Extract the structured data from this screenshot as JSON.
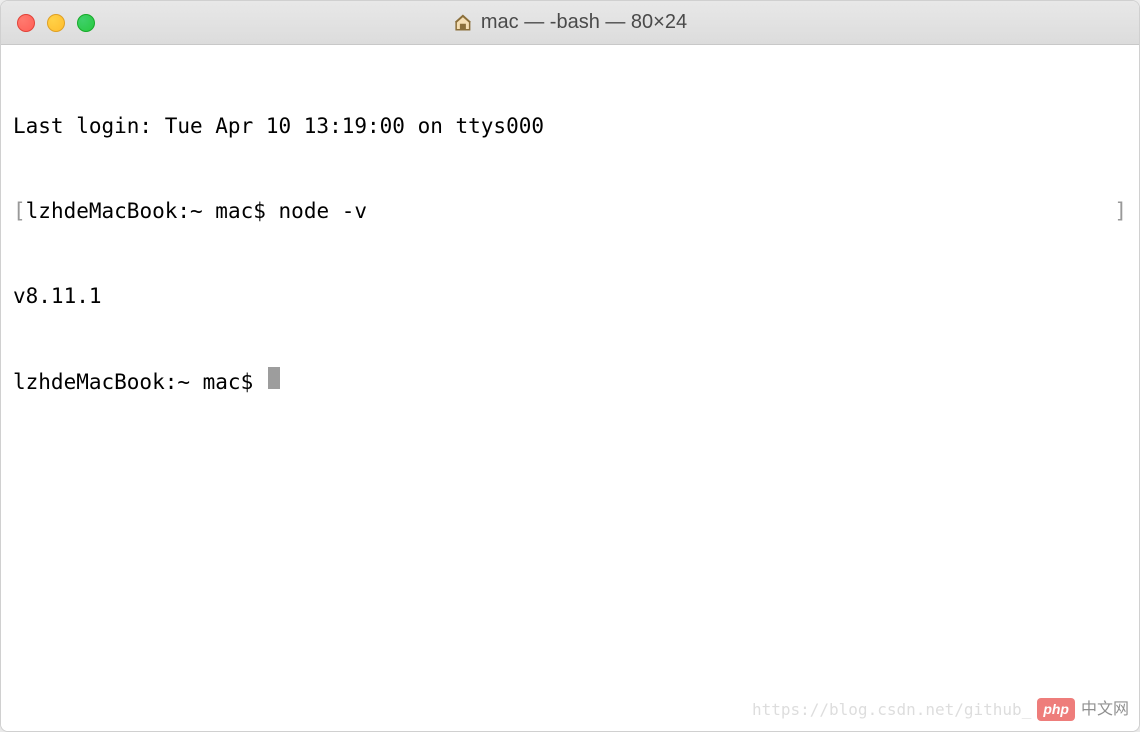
{
  "window": {
    "title": "mac — -bash — 80×24"
  },
  "terminal": {
    "line1": "Last login: Tue Apr 10 13:19:00 on ttys000",
    "line2_prompt": "lzhdeMacBook:~ mac$ ",
    "line2_cmd": "node -v",
    "line3": "v8.11.1",
    "line4_prompt": "lzhdeMacBook:~ mac$ "
  },
  "watermark": {
    "url": "https://blog.csdn.net/github_",
    "badge": "php",
    "cn": "中文网"
  }
}
